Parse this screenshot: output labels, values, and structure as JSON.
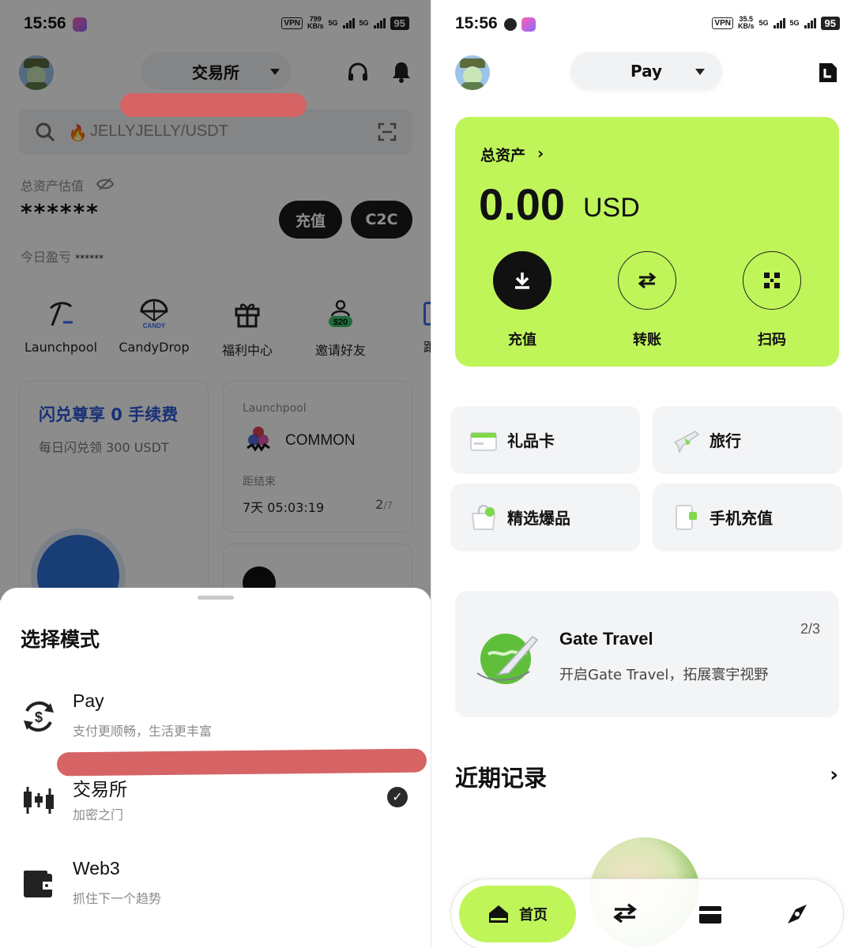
{
  "left": {
    "status": {
      "time": "15:56",
      "vpn": "VPN",
      "speed": "799",
      "speed_unit": "KB/s",
      "net1": "5G",
      "net2": "5G",
      "battery": "95"
    },
    "header": {
      "mode": "交易所"
    },
    "search": {
      "value": "JELLYJELLY/USDT"
    },
    "assets": {
      "label": "总资产估值",
      "value": "******",
      "pnl_label": "今日盈亏",
      "pnl_value": "******"
    },
    "buttons": {
      "deposit": "充值",
      "c2c": "C2C"
    },
    "quick_links": [
      {
        "label": "Launchpool",
        "icon": "pickaxe-icon"
      },
      {
        "label": "CandyDrop",
        "icon": "parachute-icon",
        "icon_text": "CANDY"
      },
      {
        "label": "福利中心",
        "icon": "gift-icon"
      },
      {
        "label": "邀请好友",
        "icon": "invite-icon",
        "icon_text": "$20"
      },
      {
        "label": "距",
        "icon": "partial-icon"
      }
    ],
    "promo": {
      "title": "闪兑尊享 0 手续费",
      "subtitle": "每日闪兑领 300 USDT"
    },
    "launchpool": {
      "label": "Launchpool",
      "token": "COMMON",
      "ends_label": "距结束",
      "countdown": "7天 05:03:19",
      "page": "2",
      "page_total": "/7"
    },
    "sheet": {
      "title": "选择模式",
      "items": [
        {
          "title": "Pay",
          "subtitle": "支付更顺畅，生活更丰富",
          "selected": false
        },
        {
          "title": "交易所",
          "subtitle": "加密之门",
          "selected": true
        },
        {
          "title": "Web3",
          "subtitle": "抓住下一个趋势",
          "selected": false
        }
      ]
    }
  },
  "right": {
    "status": {
      "time": "15:56",
      "vpn": "VPN",
      "speed": "35.5",
      "speed_unit": "KB/s",
      "net1": "5G",
      "net2": "5G",
      "battery": "95"
    },
    "header": {
      "mode": "Pay"
    },
    "balance": {
      "label": "总资产",
      "amount": "0.00",
      "currency": "USD"
    },
    "actions": [
      {
        "label": "充值",
        "icon": "download-icon"
      },
      {
        "label": "转账",
        "icon": "transfer-icon"
      },
      {
        "label": "扫码",
        "icon": "scan-icon"
      }
    ],
    "tiles": [
      {
        "label": "礼品卡",
        "icon": "gift-card-icon"
      },
      {
        "label": "旅行",
        "icon": "airplane-icon"
      },
      {
        "label": "精选爆品",
        "icon": "shopping-bag-icon"
      },
      {
        "label": "手机充值",
        "icon": "phone-topup-icon"
      }
    ],
    "travel": {
      "title": "Gate Travel",
      "subtitle": "开启Gate Travel，拓展寰宇视野",
      "page": "2/3"
    },
    "recent": {
      "title": "近期记录"
    },
    "nav": {
      "home": "首页",
      "accent": "#c0f55a"
    }
  }
}
